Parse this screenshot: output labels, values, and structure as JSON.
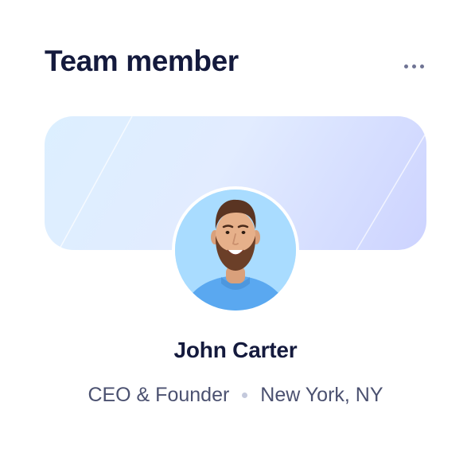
{
  "card": {
    "title": "Team member",
    "menu_icon": "more-horizontal-icon"
  },
  "member": {
    "name": "John Carter",
    "role": "CEO & Founder",
    "location": "New York, NY",
    "avatar": "portrait of a smiling bearded man in a blue t-shirt"
  },
  "colors": {
    "title": "#141a3d",
    "meta_text": "#4b5170",
    "cover_gradient_start": "#dcefff",
    "cover_gradient_end": "#cdd3ff",
    "avatar_background": "#a9dcff",
    "shirt": "#5aa8f0"
  }
}
